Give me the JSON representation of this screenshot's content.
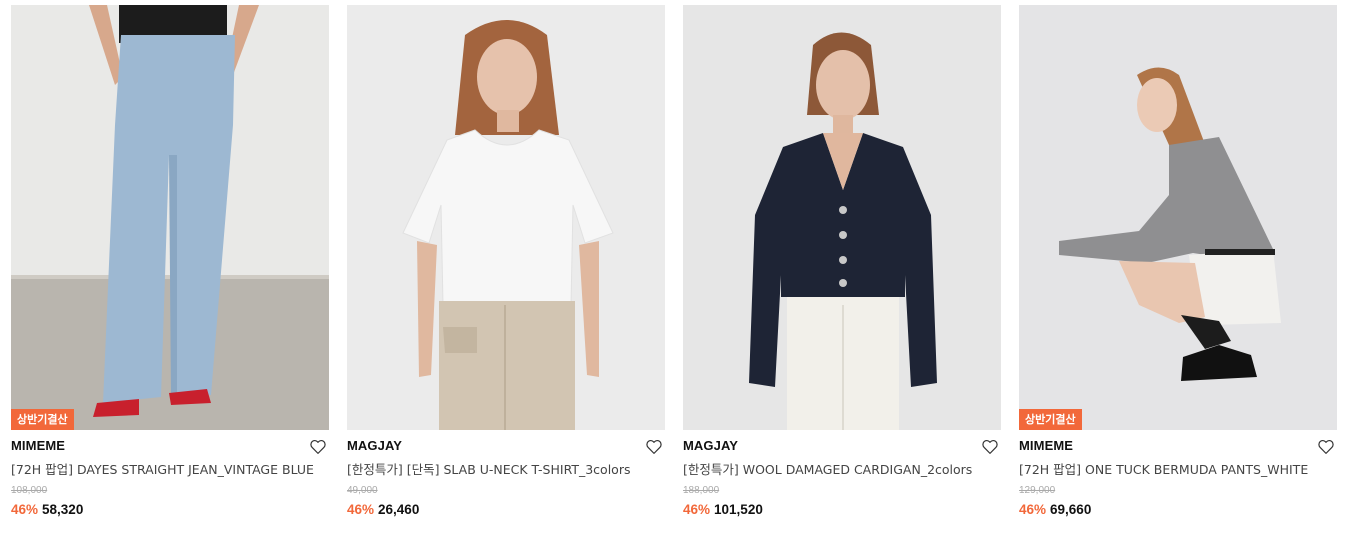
{
  "colors": {
    "accent": "#f2683a",
    "badge_bg": "#f2683a"
  },
  "products": [
    {
      "badge": "상반기결산",
      "brand": "MIMEME",
      "title": "[72H 팝업] DAYES STRAIGHT JEAN_VINTAGE BLUE",
      "original_price": "108,000",
      "discount": "46%",
      "price": "58,320",
      "image": "model in light blue straight jeans and red sandals"
    },
    {
      "badge": "",
      "brand": "MAGJAY",
      "title": "[한정특가] [단독] SLAB U-NECK T-SHIRT_3colors",
      "original_price": "49,000",
      "discount": "46%",
      "price": "26,460",
      "image": "model in white scoop-neck t-shirt and beige trousers"
    },
    {
      "badge": "",
      "brand": "MAGJAY",
      "title": "[한정특가] WOOL DAMAGED CARDIGAN_2colors",
      "original_price": "188,000",
      "discount": "46%",
      "price": "101,520",
      "image": "model in navy cropped cardigan and white jeans"
    },
    {
      "badge": "상반기결산",
      "brand": "MIMEME",
      "title": "[72H 팝업] ONE TUCK BERMUDA PANTS_WHITE",
      "original_price": "129,000",
      "discount": "46%",
      "price": "69,660",
      "image": "model crouching in grey top and white bermuda shorts"
    }
  ]
}
